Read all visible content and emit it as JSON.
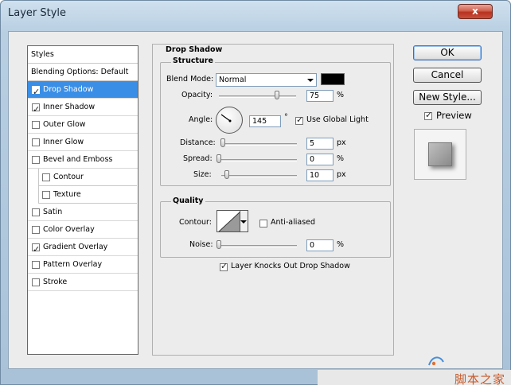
{
  "window": {
    "title": "Layer Style",
    "close_label": "x"
  },
  "styles_list": {
    "header": "Styles",
    "blending": "Blending Options: Default",
    "items": [
      {
        "label": "Drop Shadow",
        "checked": true,
        "selected": true
      },
      {
        "label": "Inner Shadow",
        "checked": true,
        "selected": false
      },
      {
        "label": "Outer Glow",
        "checked": false,
        "selected": false
      },
      {
        "label": "Inner Glow",
        "checked": false,
        "selected": false
      },
      {
        "label": "Bevel and Emboss",
        "checked": false,
        "selected": false
      },
      {
        "label": "Contour",
        "checked": false,
        "selected": false,
        "indent": true
      },
      {
        "label": "Texture",
        "checked": false,
        "selected": false,
        "indent": true
      },
      {
        "label": "Satin",
        "checked": false,
        "selected": false
      },
      {
        "label": "Color Overlay",
        "checked": false,
        "selected": false
      },
      {
        "label": "Gradient Overlay",
        "checked": true,
        "selected": false
      },
      {
        "label": "Pattern Overlay",
        "checked": false,
        "selected": false
      },
      {
        "label": "Stroke",
        "checked": false,
        "selected": false
      }
    ]
  },
  "drop_shadow": {
    "title": "Drop Shadow",
    "structure": {
      "title": "Structure",
      "blend_mode_label": "Blend Mode:",
      "blend_mode_value": "Normal",
      "shadow_color": "#000000",
      "opacity_label": "Opacity:",
      "opacity_value": "75",
      "opacity_unit": "%",
      "opacity_level": 0.75,
      "angle_label": "Angle:",
      "angle_value": "145",
      "angle_unit": "°",
      "use_global_light_label": "Use Global Light",
      "use_global_light": true,
      "distance_label": "Distance:",
      "distance_value": "5",
      "distance_unit": "px",
      "spread_label": "Spread:",
      "spread_value": "0",
      "spread_unit": "%",
      "size_label": "Size:",
      "size_value": "10",
      "size_unit": "px"
    },
    "quality": {
      "title": "Quality",
      "contour_label": "Contour:",
      "anti_aliased_label": "Anti-aliased",
      "anti_aliased": false,
      "noise_label": "Noise:",
      "noise_value": "0",
      "noise_unit": "%"
    },
    "knockout_label": "Layer Knocks Out Drop Shadow",
    "knockout": true
  },
  "buttons": {
    "ok": "OK",
    "cancel": "Cancel",
    "new_style": "New Style..."
  },
  "preview": {
    "label": "Preview",
    "checked": true
  },
  "watermark": {
    "text": "脚本之家"
  },
  "icons": {
    "check": "checkmark-icon",
    "dropdown": "chevron-down-icon"
  }
}
